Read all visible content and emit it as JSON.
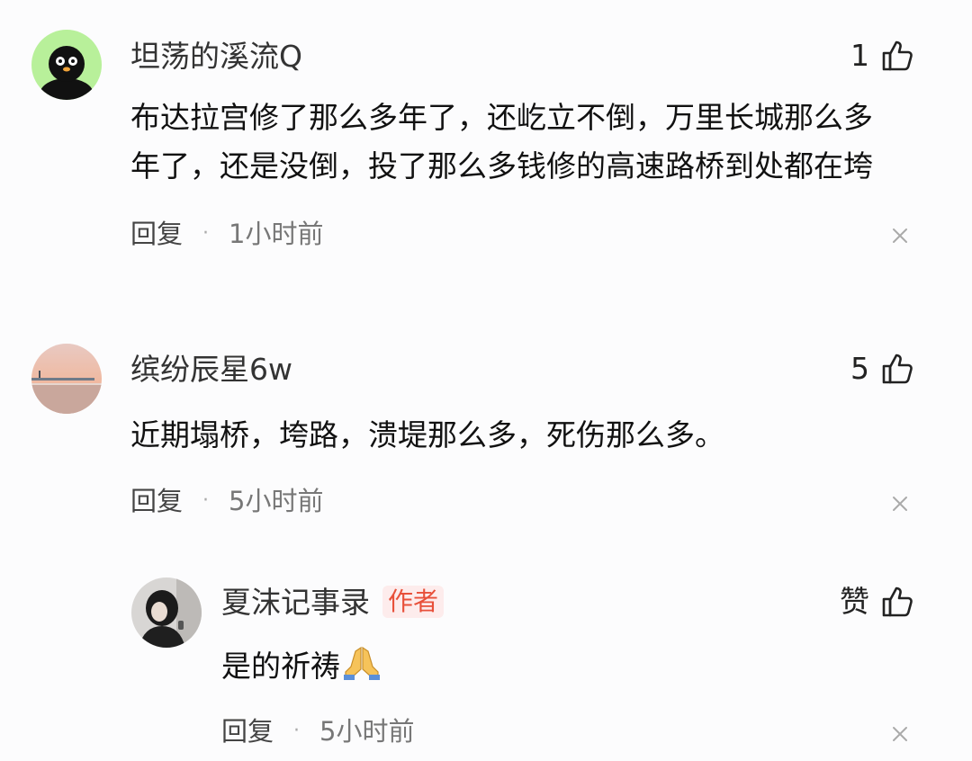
{
  "comments": [
    {
      "username": "坦荡的溪流Q",
      "likes": "1",
      "lines": [
        "布达拉宫修了那么多年了，还屹立不倒，万里长城那么多",
        "年了，还是没倒，投了那么多钱修的高速路桥到处都在垮"
      ],
      "reply_label": "回复",
      "separator": "·",
      "time": "1小时前",
      "avatar_icon": "black-cartoon-avatar-icon"
    },
    {
      "username": "缤纷辰星6w",
      "likes": "5",
      "lines": [
        "近期塌桥，垮路，溃堤那么多，死伤那么多。"
      ],
      "reply_label": "回复",
      "separator": "·",
      "time": "5小时前",
      "avatar_icon": "sunset-photo-avatar-icon"
    }
  ],
  "reply": {
    "username": "夏沫记事录",
    "badge": "作者",
    "likes_label": "赞",
    "text": "是的祈祷",
    "emoji": "folded-hands-icon",
    "reply_label": "回复",
    "separator": "·",
    "time": "5小时前",
    "avatar_icon": "person-photo-avatar-icon"
  },
  "colors": {
    "background": "#fcfcfd",
    "badge_text": "#e8503a",
    "badge_bg": "#fdecec",
    "meta_text": "#777777"
  }
}
